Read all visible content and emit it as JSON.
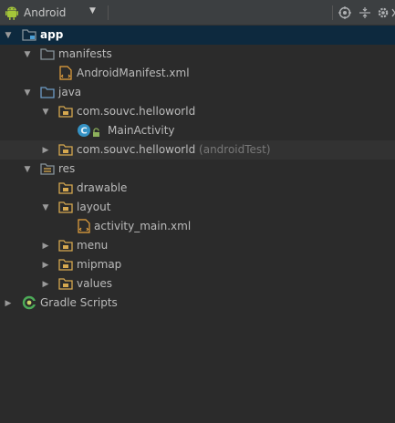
{
  "toolbar": {
    "view_mode": "Android",
    "icons": [
      "android-icon",
      "chevron-down-icon",
      "target-icon",
      "collapse-icon",
      "gear-icon",
      "hide-icon"
    ]
  },
  "tree": {
    "nodes": [
      {
        "label": "app",
        "icon": "module-folder-icon",
        "expanded": true,
        "selected": true
      },
      {
        "label": "manifests",
        "icon": "folder-icon",
        "expanded": true
      },
      {
        "label": "AndroidManifest.xml",
        "icon": "xml-file-icon"
      },
      {
        "label": "java",
        "icon": "folder-icon",
        "expanded": true
      },
      {
        "label": "com.souvc.helloworld",
        "icon": "package-icon",
        "expanded": true
      },
      {
        "label": "MainActivity",
        "icon": "class-icon"
      },
      {
        "label": "com.souvc.helloworld",
        "suffix": "(androidTest)",
        "icon": "package-icon",
        "expanded": false
      },
      {
        "label": "res",
        "icon": "resource-folder-icon",
        "expanded": true
      },
      {
        "label": "drawable",
        "icon": "package-icon"
      },
      {
        "label": "layout",
        "icon": "package-icon",
        "expanded": true
      },
      {
        "label": "activity_main.xml",
        "icon": "xml-file-icon"
      },
      {
        "label": "menu",
        "icon": "package-icon",
        "expanded": false
      },
      {
        "label": "mipmap",
        "icon": "package-icon",
        "expanded": false
      },
      {
        "label": "values",
        "icon": "package-icon",
        "expanded": false
      },
      {
        "label": "Gradle Scripts",
        "icon": "gradle-icon",
        "expanded": false
      }
    ]
  },
  "colors": {
    "background": "#2b2b2b",
    "selection": "#0d293e",
    "text": "#bbbbbb",
    "folder": "#87939a",
    "package": "#d6a84f",
    "xml": "#e8a33e",
    "class": "#3592c4"
  }
}
